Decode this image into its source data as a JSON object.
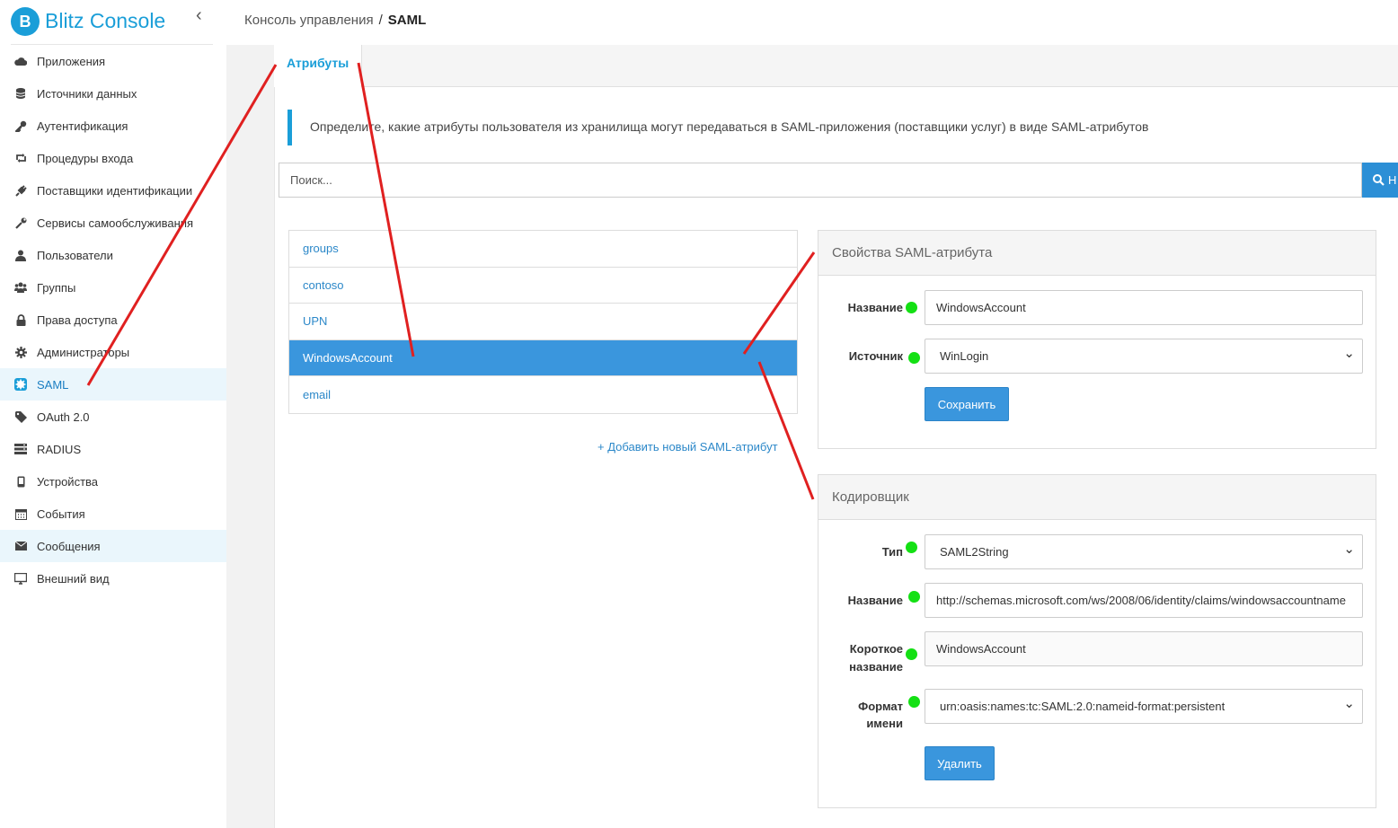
{
  "brand": {
    "logo_letter": "B",
    "title": "Blitz Console"
  },
  "breadcrumb": {
    "root": "Консоль управления",
    "separator": "/",
    "current": "SAML"
  },
  "sidebar": {
    "items": [
      {
        "label": "Приложения",
        "icon": "cloud-icon"
      },
      {
        "label": "Источники данных",
        "icon": "database-icon"
      },
      {
        "label": "Аутентификация",
        "icon": "key-icon"
      },
      {
        "label": "Процедуры входа",
        "icon": "retweet-icon"
      },
      {
        "label": "Поставщики идентификации",
        "icon": "plug-icon"
      },
      {
        "label": "Сервисы самообслуживания",
        "icon": "wrench-icon"
      },
      {
        "label": "Пользователи",
        "icon": "user-icon"
      },
      {
        "label": "Группы",
        "icon": "users-icon"
      },
      {
        "label": "Права доступа",
        "icon": "lock-icon"
      },
      {
        "label": "Администраторы",
        "icon": "gear-icon"
      },
      {
        "label": "SAML",
        "icon": "saml-icon"
      },
      {
        "label": "OAuth 2.0",
        "icon": "tag-icon"
      },
      {
        "label": "RADIUS",
        "icon": "server-icon"
      },
      {
        "label": "Устройства",
        "icon": "mobile-icon"
      },
      {
        "label": "События",
        "icon": "calendar-icon"
      },
      {
        "label": "Сообщения",
        "icon": "envelope-icon"
      },
      {
        "label": "Внешний вид",
        "icon": "monitor-icon"
      }
    ]
  },
  "tabs": {
    "active": "Атрибуты"
  },
  "info_text": "Определите, какие атрибуты пользователя из хранилища могут передаваться в SAML-приложения (поставщики услуг) в виде SAML-атрибутов",
  "search": {
    "placeholder": "Поиск...",
    "button_label": "Н"
  },
  "attributes": {
    "items": [
      "groups",
      "contoso",
      "UPN",
      "WindowsAccount",
      "email"
    ],
    "selected": "WindowsAccount",
    "add_link": "+ Добавить новый SAML-атрибут"
  },
  "properties": {
    "title": "Свойства SAML-атрибута",
    "name_label": "Название",
    "name_value": "WindowsAccount",
    "source_label": "Источник",
    "source_value": "WinLogin",
    "save_button": "Сохранить"
  },
  "encoder": {
    "title": "Кодировщик",
    "type_label": "Тип",
    "type_value": "SAML2String",
    "name_label": "Название",
    "name_value": "http://schemas.microsoft.com/ws/2008/06/identity/claims/windowsaccountname",
    "short_label_1": "Короткое",
    "short_label_2": "название",
    "short_value": "WindowsAccount",
    "format_label_1": "Формат",
    "format_label_2": "имени",
    "format_value": "urn:oasis:names:tc:SAML:2.0:nameid-format:persistent",
    "delete_button": "Удалить"
  },
  "colors": {
    "accent": "#1a9ed8",
    "selected_row": "#3a96dd",
    "indicator": "#14e014",
    "annotation": "#e02020"
  }
}
